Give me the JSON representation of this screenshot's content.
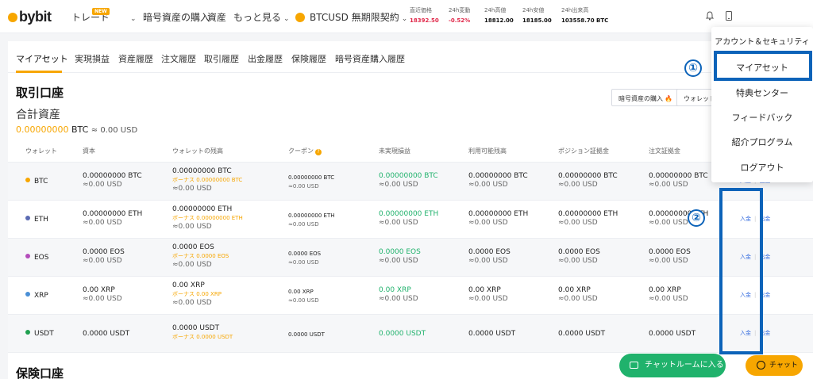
{
  "header": {
    "logo": "bybit",
    "nav": {
      "trade": "トレード",
      "new_badge": "NEW",
      "buy_crypto": "暗号資産の購入",
      "assets": "資産",
      "more": "もっと見る",
      "contract": "BTCUSD 無期限契約"
    },
    "tickers": [
      {
        "label": "直近価格",
        "value": "18392.50"
      },
      {
        "label": "24h変動",
        "value": "-0.52%"
      },
      {
        "label": "24h高値",
        "value": "18812.00"
      },
      {
        "label": "24h安値",
        "value": "18185.00"
      },
      {
        "label": "24h出来高",
        "value": "103558.70 BTC"
      }
    ]
  },
  "tabs": [
    "マイアセット",
    "実現損益",
    "資産履歴",
    "注文履歴",
    "取引履歴",
    "出金履歴",
    "保険履歴",
    "暗号資産購入履歴"
  ],
  "trading_account": {
    "title": "取引口座",
    "total_label": "合計資産",
    "total_amount": "0.00000000",
    "total_unit": "BTC",
    "total_usd": "≈ 0.00 USD",
    "buy_button": "暗号資産の購入",
    "wallet_button": "ウォレット"
  },
  "table": {
    "headers": [
      "ウォレット",
      "資本",
      "ウォレットの残高",
      "クーポン",
      "未実現損益",
      "利用可能残高",
      "ポジション証拠金",
      "注文証拠金"
    ],
    "rows": [
      {
        "coin": "BTC",
        "color": "#f7a600",
        "equity": "0.00000000 BTC",
        "equity_usd": "≈0.00 USD",
        "balance": "0.00000000 BTC",
        "bonus": "ボーナス 0.00000000 BTC",
        "balance_usd": "≈0.00 USD",
        "coupon": "0.00000000 BTC",
        "coupon_usd": "≈0.00 USD",
        "upnl": "0.00000000 BTC",
        "upnl_usd": "≈0.00 USD",
        "available": "0.00000000 BTC",
        "available_usd": "≈0.00 USD",
        "position_margin": "0.00000000 BTC",
        "position_margin_usd": "≈0.00 USD",
        "order_margin": "0.00000000 BTC",
        "order_margin_usd": "≈0.00 USD"
      },
      {
        "coin": "ETH",
        "color": "#5b6bb3",
        "equity": "0.00000000 ETH",
        "equity_usd": "≈0.00 USD",
        "balance": "0.00000000 ETH",
        "bonus": "ボーナス 0.00000000 ETH",
        "balance_usd": "≈0.00 USD",
        "coupon": "0.00000000 ETH",
        "coupon_usd": "≈0.00 USD",
        "upnl": "0.00000000 ETH",
        "upnl_usd": "≈0.00 USD",
        "available": "0.00000000 ETH",
        "available_usd": "≈0.00 USD",
        "position_margin": "0.00000000 ETH",
        "position_margin_usd": "≈0.00 USD",
        "order_margin": "0.00000000 ETH",
        "order_margin_usd": "≈0.00 USD"
      },
      {
        "coin": "EOS",
        "color": "#b44dbb",
        "equity": "0.0000 EOS",
        "equity_usd": "≈0.00 USD",
        "balance": "0.0000 EOS",
        "bonus": "ボーナス 0.0000 EOS",
        "balance_usd": "≈0.00 USD",
        "coupon": "0.0000 EOS",
        "coupon_usd": "≈0.00 USD",
        "upnl": "0.0000 EOS",
        "upnl_usd": "≈0.00 USD",
        "available": "0.0000 EOS",
        "available_usd": "≈0.00 USD",
        "position_margin": "0.0000 EOS",
        "position_margin_usd": "≈0.00 USD",
        "order_margin": "0.0000 EOS",
        "order_margin_usd": "≈0.00 USD"
      },
      {
        "coin": "XRP",
        "color": "#4a8fd6",
        "equity": "0.00 XRP",
        "equity_usd": "≈0.00 USD",
        "balance": "0.00 XRP",
        "bonus": "ボーナス 0.00 XRP",
        "balance_usd": "≈0.00 USD",
        "coupon": "0.00 XRP",
        "coupon_usd": "≈0.00 USD",
        "upnl": "0.00 XRP",
        "upnl_usd": "≈0.00 USD",
        "available": "0.00 XRP",
        "available_usd": "≈0.00 USD",
        "position_margin": "0.00 XRP",
        "position_margin_usd": "≈0.00 USD",
        "order_margin": "0.00 XRP",
        "order_margin_usd": "≈0.00 USD"
      },
      {
        "coin": "USDT",
        "color": "#20a050",
        "equity": "0.0000 USDT",
        "equity_usd": "",
        "balance": "0.0000 USDT",
        "bonus": "ボーナス 0.0000 USDT",
        "balance_usd": "",
        "coupon": "0.0000 USDT",
        "coupon_usd": "",
        "upnl": "0.0000 USDT",
        "upnl_usd": "",
        "available": "0.0000 USDT",
        "available_usd": "",
        "position_margin": "0.0000 USDT",
        "position_margin_usd": "",
        "order_margin": "0.0000 USDT",
        "order_margin_usd": ""
      }
    ],
    "deposit": "入金",
    "withdraw": "出金",
    "last_col_partial": "0.00000000 B"
  },
  "insurance_account": {
    "title": "保険口座"
  },
  "dropdown": [
    "アカウント＆セキュリティ",
    "マイアセット",
    "特典センター",
    "フィードバック",
    "紹介プログラム",
    "ログアウト"
  ],
  "annotations": {
    "one": "①",
    "two": "②"
  },
  "buttons": {
    "chat_room": "チャットルームに入る",
    "chat": "チャット"
  },
  "colors": {
    "brand": "#f7a600",
    "green": "#20b26c",
    "red": "#e0294a",
    "highlight": "#0c63b9",
    "link": "#3a70e0"
  }
}
